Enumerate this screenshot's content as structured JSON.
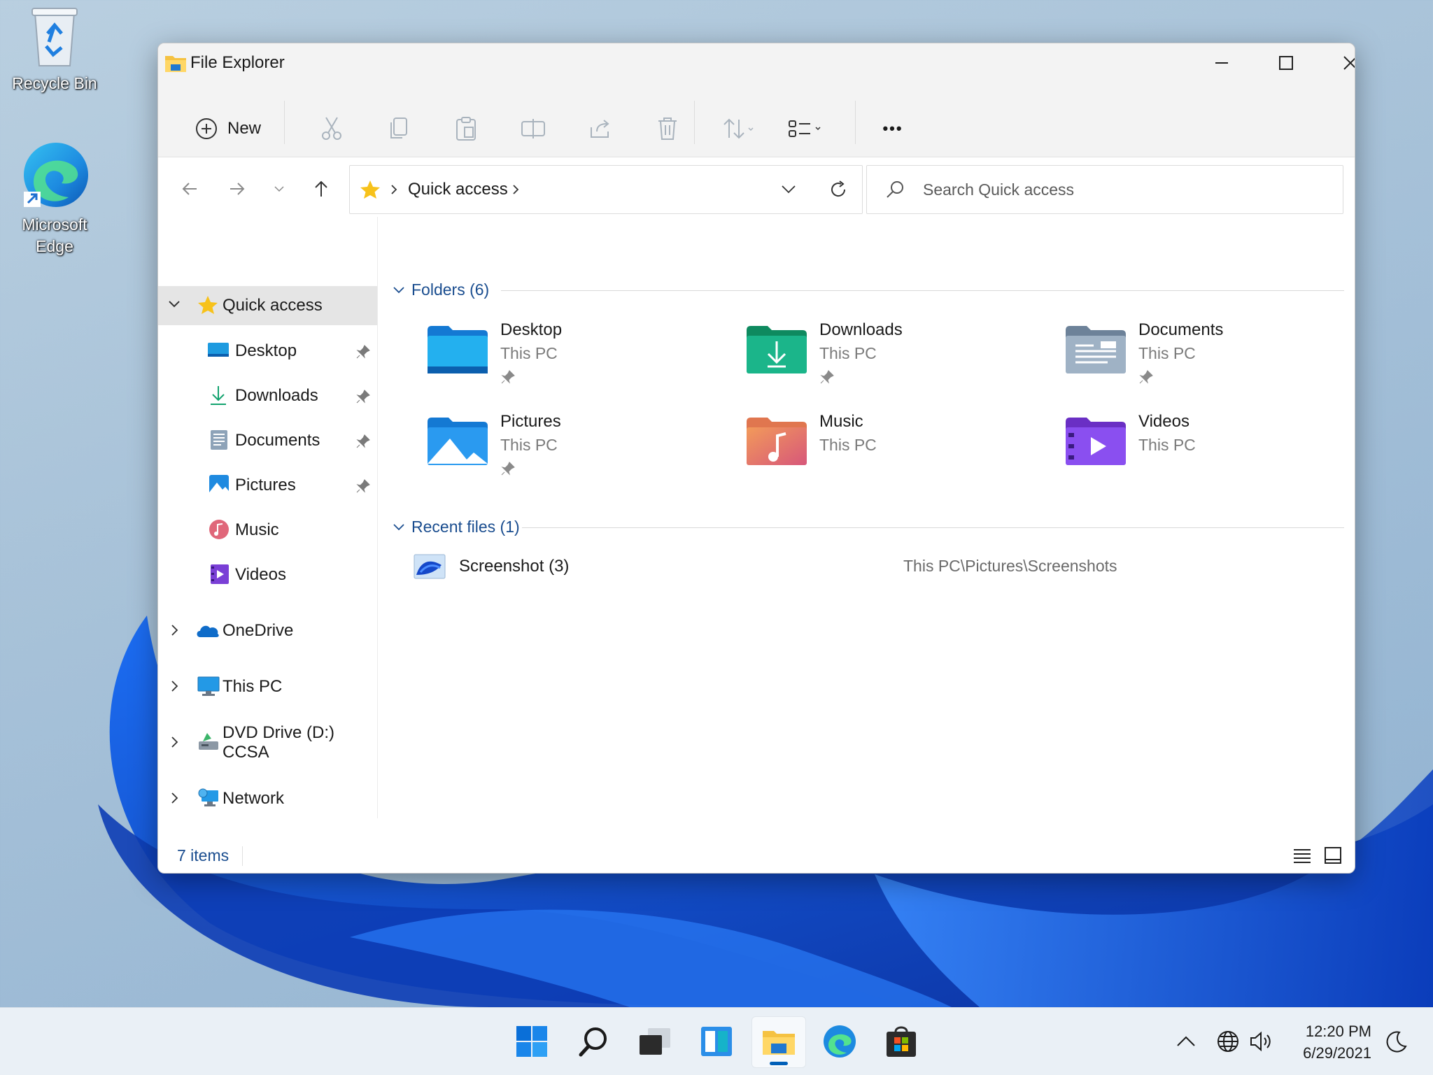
{
  "desktop": {
    "icons": [
      {
        "label": "Recycle Bin",
        "icon": "recycle-bin-icon"
      },
      {
        "label": "Microsoft Edge",
        "icon": "edge-icon"
      }
    ]
  },
  "window": {
    "title": "File Explorer",
    "toolbar": {
      "new_label": "New",
      "more_label": "•••"
    },
    "address": {
      "crumb": "Quick access",
      "search_placeholder": "Search Quick access"
    },
    "sidebar": {
      "items": [
        {
          "label": "Quick access",
          "icon": "star-icon",
          "selected": true
        },
        {
          "label": "Desktop",
          "icon": "desktop-folder-icon",
          "pinned": true
        },
        {
          "label": "Downloads",
          "icon": "download-icon",
          "pinned": true
        },
        {
          "label": "Documents",
          "icon": "documents-icon",
          "pinned": true
        },
        {
          "label": "Pictures",
          "icon": "pictures-icon",
          "pinned": true
        },
        {
          "label": "Music",
          "icon": "music-icon"
        },
        {
          "label": "Videos",
          "icon": "videos-icon"
        },
        {
          "label": "OneDrive",
          "icon": "onedrive-icon"
        },
        {
          "label": "This PC",
          "icon": "this-pc-icon"
        },
        {
          "label": "DVD Drive (D:) CCSA",
          "icon": "dvd-drive-icon"
        },
        {
          "label": "Network",
          "icon": "network-icon"
        }
      ]
    },
    "content": {
      "folders_header": "Folders (6)",
      "folders": [
        {
          "name": "Desktop",
          "location": "This PC",
          "pinned": true
        },
        {
          "name": "Downloads",
          "location": "This PC",
          "pinned": true
        },
        {
          "name": "Documents",
          "location": "This PC",
          "pinned": true
        },
        {
          "name": "Pictures",
          "location": "This PC",
          "pinned": true
        },
        {
          "name": "Music",
          "location": "This PC",
          "pinned": false
        },
        {
          "name": "Videos",
          "location": "This PC",
          "pinned": false
        }
      ],
      "recent_header": "Recent files (1)",
      "recent": [
        {
          "name": "Screenshot (3)",
          "path": "This PC\\Pictures\\Screenshots"
        }
      ]
    },
    "status": {
      "item_count": "7 items"
    }
  },
  "taskbar": {
    "time": "12:20 PM",
    "date": "6/29/2021"
  },
  "colors": {
    "accent": "#005fb8",
    "link": "#1a4d8f",
    "folder_yellow": "#f5c242"
  }
}
